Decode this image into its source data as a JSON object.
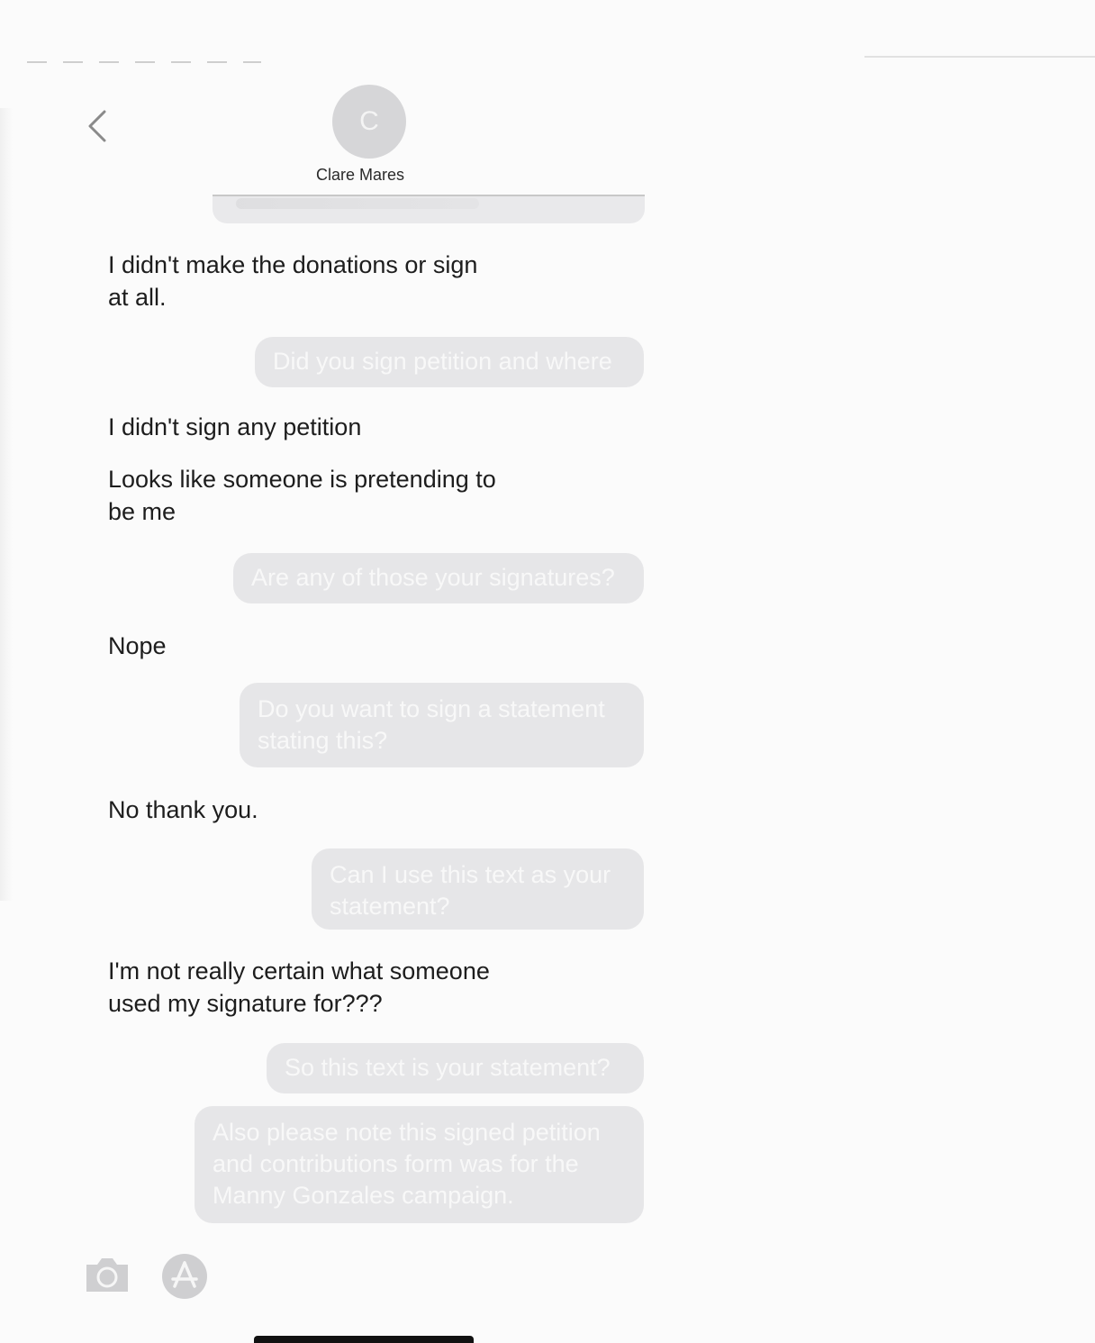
{
  "header": {
    "avatar_initial": "C",
    "contact_name": "Clare Mares"
  },
  "messages": [
    {
      "direction": "received",
      "text": "I didn't make the donations or sign\nat all."
    },
    {
      "direction": "sent",
      "text": "Did you sign petition and where"
    },
    {
      "direction": "received",
      "text": "I didn't sign any petition"
    },
    {
      "direction": "received",
      "text": "Looks like someone is pretending to\nbe me"
    },
    {
      "direction": "sent",
      "text": "Are any of those your signatures?"
    },
    {
      "direction": "received",
      "text": "Nope"
    },
    {
      "direction": "sent",
      "text": "Do you want to sign a statement\nstating this?"
    },
    {
      "direction": "received",
      "text": "No thank you."
    },
    {
      "direction": "sent",
      "text": "Can I use this text as your\nstatement?"
    },
    {
      "direction": "received",
      "text": "I'm not really certain what someone\nused my signature for???"
    },
    {
      "direction": "sent",
      "text": "So this text is your statement?"
    },
    {
      "direction": "sent",
      "text": "Also please note this signed petition\nand contributions form was for the\nManny Gonzales campaign."
    }
  ],
  "colors": {
    "sent_bubble": "#e6e6e8",
    "avatar": "#d6d6d8",
    "received_text": "#1d1d1d"
  },
  "icons": {
    "back": "chevron-left-icon",
    "camera": "camera-icon",
    "apps": "app-store-icon"
  }
}
